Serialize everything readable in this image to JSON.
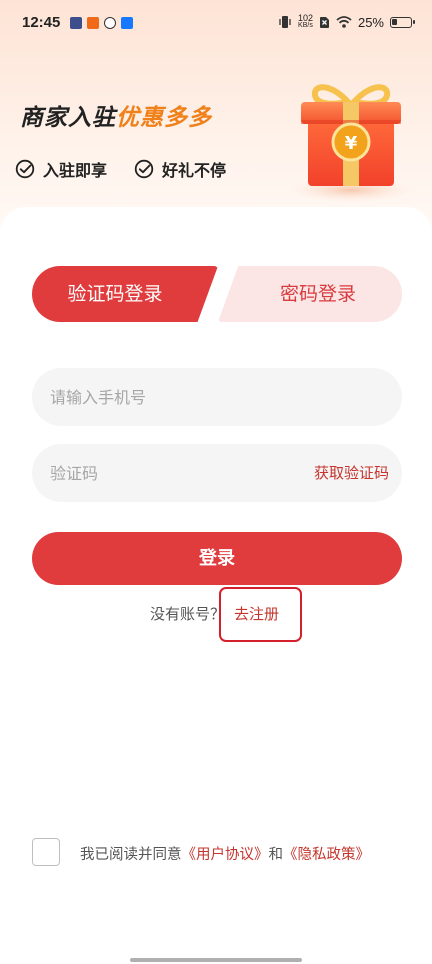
{
  "status_bar": {
    "time": "12:45",
    "net_speed_value": "102",
    "net_speed_unit": "KB/s",
    "battery": "25%",
    "icons": [
      "vibrate-icon",
      "no-sim-icon",
      "wifi-icon",
      "battery-icon"
    ]
  },
  "banner": {
    "title_part1": "商家入驻",
    "title_part2": "优惠多多",
    "features": [
      "入驻即享",
      "好礼不停"
    ],
    "gift_symbol": "¥",
    "accent_color": "#f08019"
  },
  "tabs": {
    "sms_login": "验证码登录",
    "password_login": "密码登录"
  },
  "form": {
    "phone_placeholder": "请输入手机号",
    "code_placeholder": "验证码",
    "get_code_label": "获取验证码",
    "login_label": "登录"
  },
  "register": {
    "prompt": "没有账号？",
    "link_label": "去注册"
  },
  "agreement": {
    "prefix": "我已阅读并同意",
    "user_agreement": "《用户协议》",
    "conjunction": "和",
    "privacy_policy": "《隐私政策》"
  },
  "colors": {
    "primary": "#e03b3d",
    "link": "#c5352d",
    "highlight_box": "#d3202a"
  }
}
